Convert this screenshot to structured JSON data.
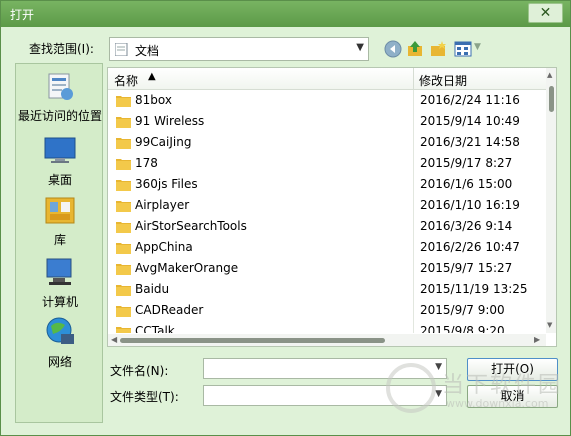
{
  "window": {
    "title": "打开",
    "close_label": "✕"
  },
  "look_in": {
    "label": "查找范围(I):",
    "value": "文档"
  },
  "places": [
    {
      "label": "最近访问的位置",
      "icon": "recent-places-icon"
    },
    {
      "label": "桌面",
      "icon": "desktop-icon"
    },
    {
      "label": "库",
      "icon": "libraries-icon"
    },
    {
      "label": "计算机",
      "icon": "computer-icon"
    },
    {
      "label": "网络",
      "icon": "network-icon"
    }
  ],
  "file_list": {
    "columns": {
      "name": "名称",
      "date": "修改日期"
    },
    "rows": [
      {
        "name": "81box",
        "date": "2016/2/24 11:16"
      },
      {
        "name": "91 Wireless",
        "date": "2015/9/14 10:49"
      },
      {
        "name": "99CaiJing",
        "date": "2016/3/21 14:58"
      },
      {
        "name": "178",
        "date": "2015/9/17 8:27"
      },
      {
        "name": "360js Files",
        "date": "2016/1/6 15:00"
      },
      {
        "name": "Airplayer",
        "date": "2016/1/10 16:19"
      },
      {
        "name": "AirStorSearchTools",
        "date": "2016/3/26 9:14"
      },
      {
        "name": "AppChina",
        "date": "2016/2/26 10:47"
      },
      {
        "name": "AvgMakerOrange",
        "date": "2015/9/7 15:27"
      },
      {
        "name": "Baidu",
        "date": "2015/11/19 13:25"
      },
      {
        "name": "CADReader",
        "date": "2015/9/7 9:00"
      },
      {
        "name": "CCTalk",
        "date": "2015/9/8 9:20"
      }
    ]
  },
  "file_name": {
    "label": "文件名(N):",
    "value": ""
  },
  "file_type": {
    "label": "文件类型(T):",
    "value": ""
  },
  "buttons": {
    "open": "打开(O)",
    "cancel": "取消"
  },
  "watermark": {
    "big": "当下软件园",
    "small": "www.downxia.com"
  },
  "colors": {
    "title_bar": "#5c9a48",
    "dialog_bg": "#dff2d8",
    "folder": "#e8b632"
  }
}
